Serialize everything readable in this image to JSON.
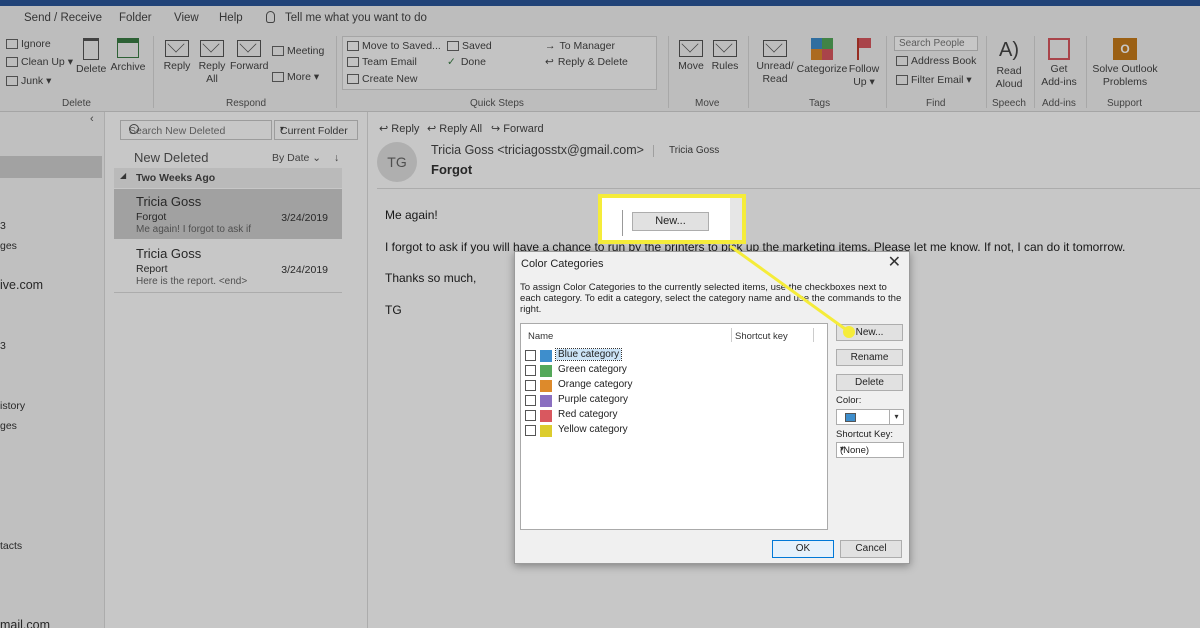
{
  "menu": {
    "items": [
      "Send / Receive",
      "Folder",
      "View",
      "Help"
    ],
    "tell_me": "Tell me what you want to do"
  },
  "ribbon": {
    "delete_group": {
      "ignore": "Ignore",
      "clean_up": "Clean Up ▾",
      "junk": "Junk ▾",
      "delete": "Delete",
      "archive": "Archive",
      "label": "Delete"
    },
    "respond_group": {
      "reply": "Reply",
      "reply_all_1": "Reply",
      "reply_all_2": "All",
      "forward": "Forward",
      "meeting": "Meeting",
      "more": "More ▾",
      "label": "Respond"
    },
    "quick_steps": {
      "move_to_saved": "Move to Saved...",
      "team_email": "Team Email",
      "create_new": "Create New",
      "saved": "Saved",
      "done": "Done",
      "to_manager": "To Manager",
      "reply_delete": "Reply & Delete",
      "label": "Quick Steps"
    },
    "move_group": {
      "move": "Move",
      "rules": "Rules",
      "label": "Move"
    },
    "tags_group": {
      "unread_read_1": "Unread/",
      "unread_read_2": "Read",
      "categorize": "Categorize",
      "follow_up_1": "Follow",
      "follow_up_2": "Up ▾",
      "label": "Tags"
    },
    "find_group": {
      "search_people": "Search People",
      "address_book": "Address Book",
      "filter_email": "Filter Email ▾",
      "label": "Find"
    },
    "speech_group": {
      "read_aloud_1": "Read",
      "read_aloud_2": "Aloud",
      "label": "Speech"
    },
    "addins_group": {
      "get_addins_1": "Get",
      "get_addins_2": "Add-ins",
      "label": "Add-ins"
    },
    "support_group": {
      "solve_1": "Solve Outlook",
      "solve_2": "Problems",
      "label": "Support"
    }
  },
  "folder_pane": {
    "items": [
      "3",
      "ges",
      "ive.com",
      "3",
      "istory",
      "ges",
      "tacts",
      "mail.com"
    ]
  },
  "message_list": {
    "search_placeholder": "Search New Deleted",
    "scope": "Current Folder",
    "folder_title": "New Deleted",
    "sort": "By Date",
    "group": "Two Weeks Ago",
    "messages": [
      {
        "from": "Tricia Goss",
        "subject": "Forgot",
        "preview": "Me again!  I forgot to ask if",
        "date": "3/24/2019"
      },
      {
        "from": "Tricia Goss",
        "subject": "Report",
        "preview": "Here is the report. <end>",
        "date": "3/24/2019"
      }
    ]
  },
  "reading_pane": {
    "actions": {
      "reply": "Reply",
      "reply_all": "Reply All",
      "forward": "Forward"
    },
    "avatar_initials": "TG",
    "sender": "Tricia Goss <triciagosstx@gmail.com>",
    "to": "Tricia Goss",
    "subject": "Forgot",
    "body": [
      "Me again!",
      "I forgot to ask if you will have a chance to run by the printers to pick up the marketing items. Please let me know. If not, I can do it tomorrow.",
      "Thanks so much,",
      "TG"
    ]
  },
  "dialog": {
    "title": "Color Categories",
    "description": "To assign Color Categories to the currently selected items, use the checkboxes next to each category.  To edit a category, select the category name and use the commands to the right.",
    "col_name": "Name",
    "col_shortcut": "Shortcut key",
    "categories": [
      {
        "name": "Blue category",
        "color": "#3e8ecc"
      },
      {
        "name": "Green category",
        "color": "#54a85a"
      },
      {
        "name": "Orange category",
        "color": "#dd8a2b"
      },
      {
        "name": "Purple category",
        "color": "#8a6fc0"
      },
      {
        "name": "Red category",
        "color": "#d9585f"
      },
      {
        "name": "Yellow category",
        "color": "#dccc2e"
      }
    ],
    "new_button": "New...",
    "rename_button": "Rename",
    "delete_button": "Delete",
    "color_label": "Color:",
    "shortcut_label": "Shortcut Key:",
    "shortcut_value": "(None)",
    "ok_button": "OK",
    "cancel_button": "Cancel"
  },
  "callout": {
    "button": "New..."
  },
  "colors": {
    "highlight": "#f5ec3a",
    "accent": "#2b579a"
  }
}
